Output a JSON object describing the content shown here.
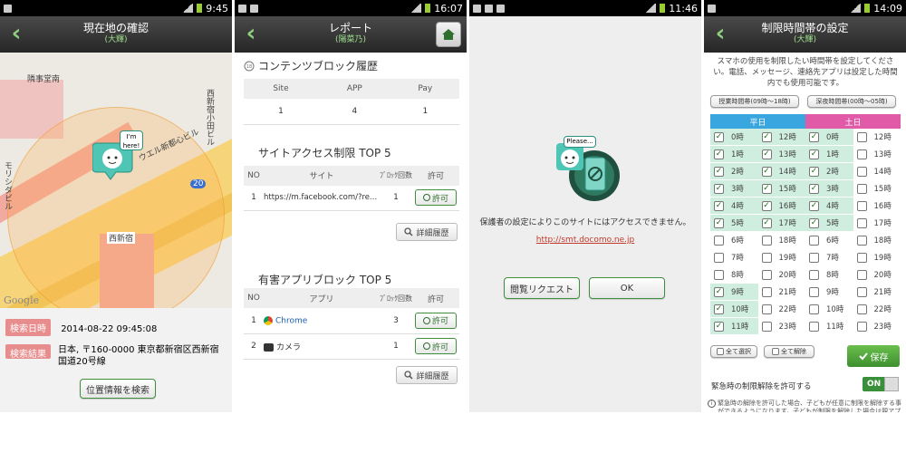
{
  "screen1": {
    "status_time": "9:45",
    "title": "現在地の確認",
    "subtitle": "(大輝)",
    "map_labels": [
      "隣事堂南",
      "西新宿小田ビル",
      "ウエル新都心ビル",
      "モリシダビル",
      "西新宿",
      "20"
    ],
    "bubble_text": "I'm here!",
    "google": "Google",
    "search_time_label": "検索日時",
    "search_time_value": "2014-08-22 09:45:08",
    "search_result_label": "検索結果",
    "search_result_value": "日本, 〒160-0000 東京都新宿区西新宿 国道20号線",
    "search_button": "位置情報を検索"
  },
  "screen2": {
    "status_time": "16:07",
    "title": "レポート",
    "subtitle": "(陽菜乃)",
    "content_block_title": "コンテンツブロック履歴",
    "summary_headers": [
      "Site",
      "APP",
      "Pay"
    ],
    "summary_values": [
      "1",
      "4",
      "1"
    ],
    "site_section_title": "サイトアクセス制限 TOP 5",
    "site_headers": [
      "NO",
      "サイト",
      "ﾌﾞﾛｯｸ回数",
      "許可"
    ],
    "site_rows": [
      {
        "no": "1",
        "name": "https://m.facebook.com/?re...",
        "count": "1",
        "action": "許可"
      }
    ],
    "detail_button": "詳細履歴",
    "app_section_title": "有害アプリブロック TOP 5",
    "app_headers": [
      "NO",
      "アプリ",
      "ﾌﾞﾛｯｸ回数",
      "許可"
    ],
    "app_rows": [
      {
        "no": "1",
        "name": "Chrome",
        "count": "3",
        "action": "許可"
      },
      {
        "no": "2",
        "name": "カメラ",
        "count": "1",
        "action": "許可"
      }
    ]
  },
  "screen3": {
    "status_time": "11:46",
    "bubble_text": "Please...",
    "message": "保護者の設定によりこのサイトにはアクセスできません。",
    "link": "http://smt.docomo.ne.jp",
    "request_button": "閲覧リクエスト",
    "ok_button": "OK"
  },
  "screen4": {
    "status_time": "14:09",
    "title": "制限時間帯の設定",
    "subtitle": "(大輝)",
    "description": "スマホの使用を制限したい時間帯を設定してください。電話、メッセージ、連絡先アプリは設定した時間内でも使用可能です。",
    "preset_school": "授業時間帯(09時〜18時)",
    "preset_night": "深夜時間帯(00時〜05時)",
    "weekday_label": "平日",
    "weekend_label": "土日",
    "weekday_color": "#3aa6e0",
    "weekend_color": "#e05aa8",
    "rows": [
      {
        "a": "0時",
        "ac": true,
        "b": "12時",
        "bc": true,
        "c": "0時",
        "cc": true,
        "d": "12時",
        "dc": false
      },
      {
        "a": "1時",
        "ac": true,
        "b": "13時",
        "bc": true,
        "c": "1時",
        "cc": true,
        "d": "13時",
        "dc": false
      },
      {
        "a": "2時",
        "ac": true,
        "b": "14時",
        "bc": true,
        "c": "2時",
        "cc": true,
        "d": "14時",
        "dc": false
      },
      {
        "a": "3時",
        "ac": true,
        "b": "15時",
        "bc": true,
        "c": "3時",
        "cc": true,
        "d": "15時",
        "dc": false
      },
      {
        "a": "4時",
        "ac": true,
        "b": "16時",
        "bc": true,
        "c": "4時",
        "cc": true,
        "d": "16時",
        "dc": false
      },
      {
        "a": "5時",
        "ac": true,
        "b": "17時",
        "bc": true,
        "c": "5時",
        "cc": true,
        "d": "17時",
        "dc": false
      },
      {
        "a": "6時",
        "ac": false,
        "b": "18時",
        "bc": false,
        "c": "6時",
        "cc": false,
        "d": "18時",
        "dc": false
      },
      {
        "a": "7時",
        "ac": false,
        "b": "19時",
        "bc": false,
        "c": "7時",
        "cc": false,
        "d": "19時",
        "dc": false
      },
      {
        "a": "8時",
        "ac": false,
        "b": "20時",
        "bc": false,
        "c": "8時",
        "cc": false,
        "d": "20時",
        "dc": false
      },
      {
        "a": "9時",
        "ac": true,
        "b": "21時",
        "bc": false,
        "c": "9時",
        "cc": false,
        "d": "21時",
        "dc": false
      },
      {
        "a": "10時",
        "ac": true,
        "b": "22時",
        "bc": false,
        "c": "10時",
        "cc": false,
        "d": "22時",
        "dc": false
      },
      {
        "a": "11時",
        "ac": true,
        "b": "23時",
        "bc": false,
        "c": "11時",
        "cc": false,
        "d": "23時",
        "dc": false
      }
    ],
    "select_all": "全て選択",
    "clear_all": "全て解除",
    "save_button": "保存",
    "emergency_label": "緊急時の制限解除を許可する",
    "toggle_label": "ON",
    "note": "緊急時の解除を許可した場合、子どもが任意に制限を解除する事ができるようになります。子どもが制限を解除した場合は親アプリにその旨が通知され、1時間の間全ての制限が解除されます。"
  }
}
